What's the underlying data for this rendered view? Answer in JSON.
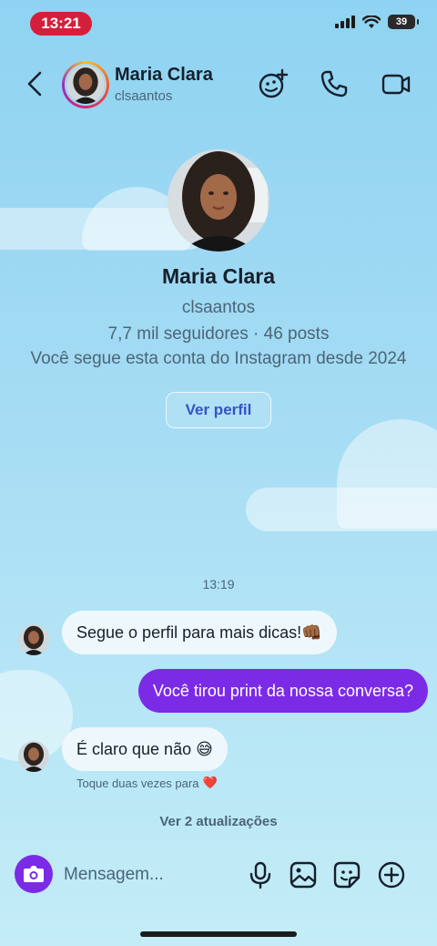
{
  "status_bar": {
    "time": "13:21",
    "battery": "39"
  },
  "header": {
    "name": "Maria Clara",
    "username": "clsaantos",
    "icons": [
      "back-arrow",
      "add-effects",
      "phone",
      "video-camera"
    ]
  },
  "profile": {
    "name": "Maria Clara",
    "username": "clsaantos",
    "stats": "7,7 mil seguidores · 46 posts",
    "follow_info": "Você segue esta conta do Instagram desde 2024",
    "view_profile_label": "Ver perfil"
  },
  "chat": {
    "timestamp": "13:19",
    "messages": [
      {
        "direction": "in",
        "text": "Segue o perfil para mais dicas!👊🏾"
      },
      {
        "direction": "out",
        "text": "Você tirou print da nossa conversa?"
      },
      {
        "direction": "in",
        "text": "É claro que não 😅"
      }
    ],
    "reaction_hint": "Toque duas vezes para",
    "reaction_emoji": "❤️",
    "updates_link": "Ver 2 atualizações"
  },
  "composer": {
    "placeholder": "Mensagem...",
    "icons": [
      "camera",
      "microphone",
      "image",
      "sticker",
      "plus"
    ]
  },
  "colors": {
    "accent_purple": "#7b2be6",
    "time_pill": "#d51f3a",
    "link_blue": "#3553c9"
  }
}
